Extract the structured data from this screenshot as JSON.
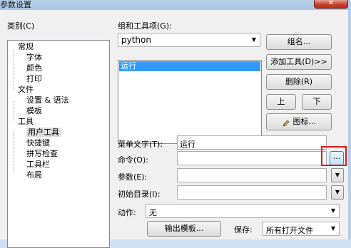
{
  "window": {
    "title": "参数设置",
    "close_label": "✕"
  },
  "category": {
    "label": "类别(C)",
    "items": [
      "常规",
      "字体",
      "颜色",
      "打印",
      "文件",
      "设置 & 语法",
      "模板",
      "工具",
      "用户工具",
      "快捷键",
      "拼写检查",
      "工具栏",
      "布局"
    ],
    "selected": "用户工具"
  },
  "groups": {
    "label": "组和工具项(G):",
    "selected_group": "python",
    "list": [
      "运行"
    ],
    "selected_item": "运行"
  },
  "buttons": {
    "group_name": "组名...",
    "add_tool": "添加工具(D)>>",
    "delete": "删除(R)",
    "up": "上",
    "down": "下",
    "icon": "图标...",
    "browse": "...",
    "output_template": "输出模板..."
  },
  "fields": {
    "menu_text_label": "菜单文字(T):",
    "menu_text_value": "运行",
    "command_label": "命令(O):",
    "command_value": "",
    "args_label": "参数(E):",
    "args_value": "",
    "initdir_label": "初始目录(I):",
    "initdir_value": "",
    "action_label": "动作:",
    "action_value": "无",
    "save_label": "保存:",
    "save_value": "所有打开文件"
  },
  "colors": {
    "highlight_box": "#e0191b",
    "selection": "#3399ff"
  }
}
